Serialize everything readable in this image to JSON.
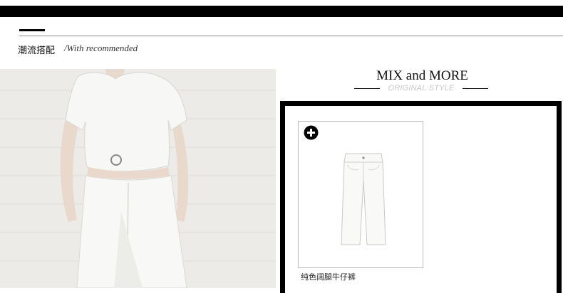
{
  "section": {
    "title": "潮流搭配",
    "subtitle": "/With recommended"
  },
  "mix": {
    "title": "MIX and MORE",
    "subtitle": "ORIGINAL STYLE"
  },
  "product": {
    "name": "纯色阔腿牛仔裤",
    "add_icon": "plus-circle-icon"
  },
  "colors": {
    "bar": "#000000",
    "frame": "#000000",
    "subtitle_gray": "#c8c8c8"
  }
}
